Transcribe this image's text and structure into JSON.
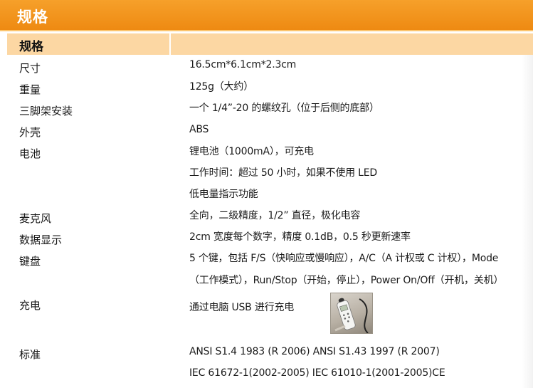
{
  "header": {
    "title": "规格"
  },
  "section": {
    "title": "规格"
  },
  "specs": [
    {
      "label": "尺寸",
      "values": [
        "16.5cm*6.1cm*2.3cm"
      ]
    },
    {
      "label": "重量",
      "values": [
        "125g（大约）"
      ]
    },
    {
      "label": "三脚架安装",
      "values": [
        "一个 1/4”-20 的螺纹孔（位于后侧的底部）"
      ]
    },
    {
      "label": "外壳",
      "values": [
        "ABS"
      ]
    },
    {
      "label": "电池",
      "values": [
        "锂电池（1000mA），可充电",
        "工作时间：超过 50 小时，如果不使用 LED",
        "低电量指示功能"
      ]
    },
    {
      "label": "麦克风",
      "values": [
        "全向，二级精度，1/2” 直径，极化电容"
      ]
    },
    {
      "label": "数据显示",
      "values": [
        "2cm 宽度每个数字，精度 0.1dB，0.5 秒更新速率"
      ]
    },
    {
      "label": "键盘",
      "values": [
        "5 个键，包括 F/S（快响应或慢响应），A/C（A 计权或 C 计权），Mode",
        "（工作模式），Run/Stop（开始，停止），Power On/Off（开机，关机）"
      ]
    },
    {
      "label": "充电",
      "values": [
        "通过电脑 USB 进行充电"
      ]
    },
    {
      "label": "标准",
      "values": [
        "ANSI S1.4 1983 (R 2006) ANSI S1.43 1997 (R 2007)",
        "IEC 61672-1(2002-2005) IEC 61010-1(2001-2005)CE"
      ]
    }
  ],
  "colors": {
    "accent": "#ee8a12",
    "section_bg": "#fcd7a3"
  }
}
